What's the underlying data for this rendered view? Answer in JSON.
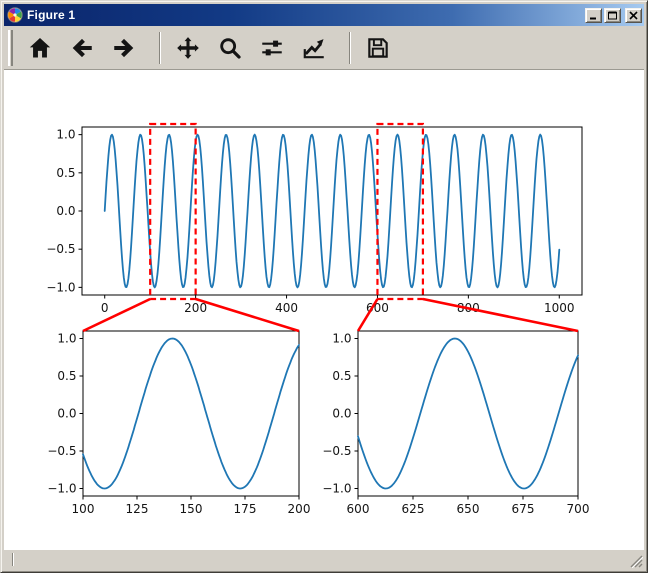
{
  "window": {
    "title": "Figure 1",
    "controls": {
      "minimize": "minimize",
      "maximize": "maximize",
      "close": "close"
    }
  },
  "toolbar": {
    "buttons": [
      {
        "name": "home",
        "icon": "home-icon"
      },
      {
        "name": "back",
        "icon": "arrow-left-icon"
      },
      {
        "name": "forward",
        "icon": "arrow-right-icon"
      },
      {
        "name": "pan",
        "icon": "move-arrows-icon"
      },
      {
        "name": "zoom-to-rect",
        "icon": "magnifier-icon"
      },
      {
        "name": "configure-subplots",
        "icon": "sliders-icon"
      },
      {
        "name": "edit-parameters",
        "icon": "chart-arrow-icon"
      },
      {
        "name": "save",
        "icon": "floppy-disk-icon"
      }
    ]
  },
  "status_bar": {
    "message": ""
  },
  "colors": {
    "chrome": "#d4d0c8",
    "titlebar_left": "#0a246a",
    "titlebar_right": "#a6caf0",
    "line": "#1f77b4",
    "zoom_box": "#ff0000",
    "axes_frame": "#000000",
    "canvas_bg": "#ffffff"
  },
  "chart_data": [
    {
      "id": "overview",
      "type": "line",
      "title": "",
      "xlabel": "",
      "ylabel": "",
      "series": {
        "name": "sin(x/10)",
        "expression": "sin(x/10)",
        "amplitude": 1,
        "frequency": 0.1
      },
      "x_start": 0,
      "x_end": 1000,
      "x_step": 2,
      "xlim": [
        -50,
        1050
      ],
      "ylim": [
        -1.1,
        1.1
      ],
      "grid": false,
      "line_color": "#1f77b4",
      "xticks": {
        "values": [
          0,
          200,
          400,
          600,
          800,
          1000
        ],
        "labels": [
          "0",
          "200",
          "400",
          "600",
          "800",
          "1000"
        ]
      },
      "yticks": {
        "values": [
          -1.0,
          -0.5,
          0.0,
          0.5,
          1.0
        ],
        "labels": [
          "−1.0",
          "−0.5",
          "0.0",
          "0.5",
          "1.0"
        ]
      },
      "zoom_regions": [
        {
          "x0": 100,
          "x1": 200,
          "target": "zoom-left",
          "color": "#ff0000",
          "style": "dashed"
        },
        {
          "x0": 600,
          "x1": 700,
          "target": "zoom-right",
          "color": "#ff0000",
          "style": "dashed"
        }
      ]
    },
    {
      "id": "zoom-left",
      "type": "line",
      "title": "",
      "xlabel": "",
      "ylabel": "",
      "series": {
        "name": "sin(x/10)",
        "expression": "sin(x/10)",
        "amplitude": 1,
        "frequency": 0.1
      },
      "x_start": 100,
      "x_end": 200,
      "x_step": 0.5,
      "xlim": [
        100,
        200
      ],
      "ylim": [
        -1.1,
        1.1
      ],
      "grid": false,
      "line_color": "#1f77b4",
      "xticks": {
        "values": [
          100,
          125,
          150,
          175,
          200
        ],
        "labels": [
          "100",
          "125",
          "150",
          "175",
          "200"
        ]
      },
      "yticks": {
        "values": [
          -1.0,
          -0.5,
          0.0,
          0.5,
          1.0
        ],
        "labels": [
          "−1.0",
          "−0.5",
          "0.0",
          "0.5",
          "1.0"
        ]
      }
    },
    {
      "id": "zoom-right",
      "type": "line",
      "title": "",
      "xlabel": "",
      "ylabel": "",
      "series": {
        "name": "sin(x/10)",
        "expression": "sin(x/10)",
        "amplitude": 1,
        "frequency": 0.1
      },
      "x_start": 600,
      "x_end": 700,
      "x_step": 0.5,
      "xlim": [
        600,
        700
      ],
      "ylim": [
        -1.1,
        1.1
      ],
      "grid": false,
      "line_color": "#1f77b4",
      "xticks": {
        "values": [
          600,
          625,
          650,
          675,
          700
        ],
        "labels": [
          "600",
          "625",
          "650",
          "675",
          "700"
        ]
      },
      "yticks": {
        "values": [
          -1.0,
          -0.5,
          0.0,
          0.5,
          1.0
        ],
        "labels": [
          "−1.0",
          "−0.5",
          "0.0",
          "0.5",
          "1.0"
        ]
      }
    }
  ]
}
